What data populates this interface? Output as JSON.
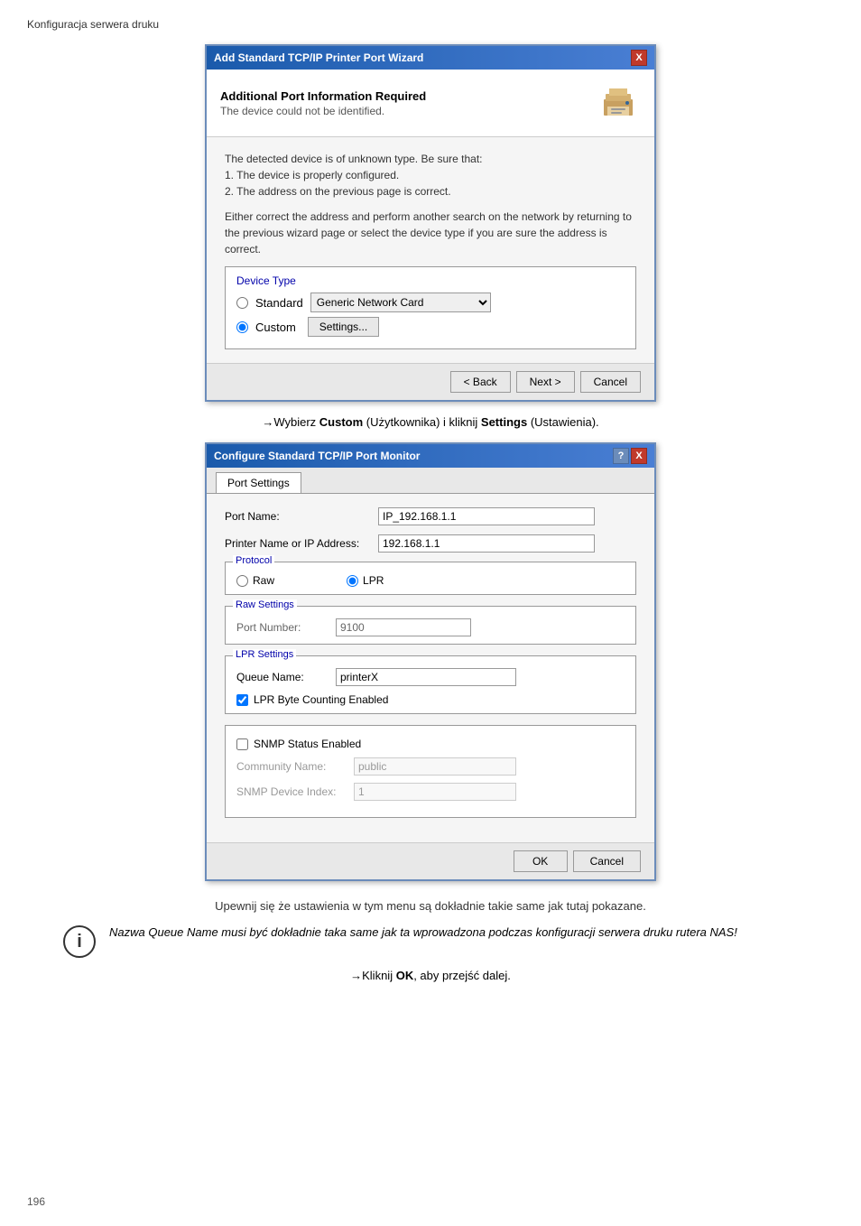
{
  "page": {
    "label": "Konfiguracja serwera druku",
    "number": "196"
  },
  "wizard": {
    "title": "Add Standard TCP/IP Printer Port Wizard",
    "close_label": "X",
    "header_title": "Additional Port Information Required",
    "header_subtitle": "The device could not be identified.",
    "body_text1": "The detected device is of unknown type.  Be sure that:",
    "body_text2": "1. The device is properly configured.",
    "body_text3": "2. The address on the previous page is correct.",
    "body_text4": "Either correct the address and perform another search on the network by returning to the previous wizard page or select the device type if you are sure the address is correct.",
    "device_type_label": "Device Type",
    "standard_label": "Standard",
    "custom_label": "Custom",
    "dropdown_value": "Generic Network Card",
    "settings_btn": "Settings...",
    "back_btn": "< Back",
    "next_btn": "Next >",
    "cancel_btn": "Cancel"
  },
  "instruction": "→Wybierz Custom (Użytkownika) i kliknij Settings (Ustawienia).",
  "configure": {
    "title": "Configure Standard TCP/IP Port Monitor",
    "help_label": "?",
    "close_label": "X",
    "tab_label": "Port Settings",
    "port_name_label": "Port Name:",
    "port_name_value": "IP_192.168.1.1",
    "printer_ip_label": "Printer Name or IP Address:",
    "printer_ip_value": "192.168.1.1",
    "protocol_label": "Protocol",
    "raw_label": "Raw",
    "lpr_label": "LPR",
    "raw_settings_label": "Raw Settings",
    "port_number_label": "Port Number:",
    "port_number_value": "9100",
    "lpr_settings_label": "LPR Settings",
    "queue_name_label": "Queue Name:",
    "queue_name_value": "printerX",
    "lpr_byte_label": "LPR Byte Counting Enabled",
    "snmp_status_label": "SNMP Status Enabled",
    "community_label": "Community Name:",
    "community_value": "public",
    "snmp_index_label": "SNMP Device Index:",
    "snmp_index_value": "1",
    "ok_btn": "OK",
    "cancel_btn": "Cancel"
  },
  "bottom_note": "Upewnij się że ustawienia w tym menu są dokładnie takie same jak tutaj pokazane.",
  "info_text": "Nazwa Queue Name musi być dokładnie taka same jak ta wprowadzona podczas konfiguracji serwera druku rutera NAS!",
  "final_instruction": "→Kliknij OK, aby przejść dalej."
}
